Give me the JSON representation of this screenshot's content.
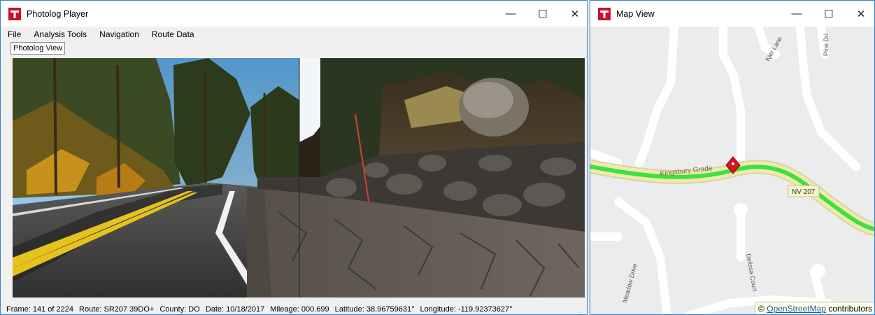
{
  "photolog": {
    "title": "Photolog Player",
    "controls": {
      "minimize": "—",
      "maximize": "☐",
      "close": "✕"
    },
    "menu": [
      "File",
      "Analysis Tools",
      "Navigation",
      "Route Data"
    ],
    "tab": "Photolog View",
    "status": {
      "frame": "Frame: 141 of 2224",
      "route": "Route: SR207 39DO+",
      "county": "County: DO",
      "date": "Date: 10/18/2017",
      "mileage": "Mileage: 000.699",
      "latitude": "Latitude: 38.96759631°",
      "longitude": "Longitude: -119.92373627°"
    }
  },
  "map": {
    "title": "Map View",
    "controls": {
      "minimize": "—",
      "maximize": "☐",
      "close": "✕"
    },
    "labels": {
      "kjer": "Kjer Lane",
      "pine": "Pine Dri",
      "kingsbury": "Kingsbury Grade",
      "shield": "NV 207",
      "meadow": "Meadow Drive",
      "delissa": "Delissa Court"
    },
    "attribution": {
      "prefix": "©",
      "link": "OpenStreetMap",
      "suffix": "contributors"
    }
  },
  "colors": {
    "titlebar_accent": "#3c82c8",
    "route_highlight": "#3fe03f",
    "marker": "#d8141c",
    "road_casing": "#eeeab0"
  }
}
